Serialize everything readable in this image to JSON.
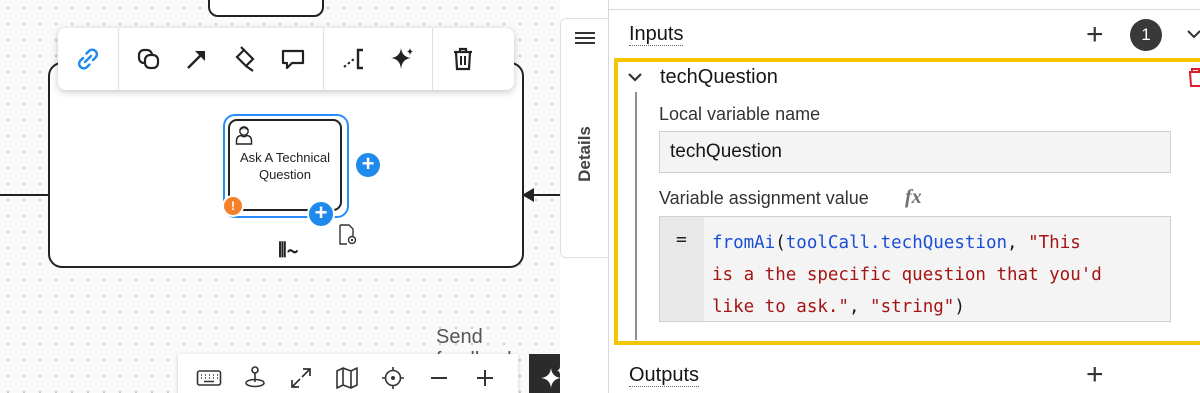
{
  "canvas": {
    "task": {
      "label": "Ask A Technical Question"
    },
    "context_toolbar": {
      "items": [
        "link-icon",
        "change-type-icon",
        "connect-arrow-icon",
        "color-bucket-icon",
        "comment-icon",
        "text-annotation-icon",
        "ai-sparkle-icon",
        "delete-icon"
      ]
    },
    "send_feedback": "Send feedback",
    "bottom_toolbar": {
      "items": [
        "keyboard-icon",
        "joystick-icon",
        "fullscreen-icon",
        "minimap-icon",
        "recenter-icon",
        "zoom-out-icon",
        "zoom-in-icon"
      ]
    },
    "loop_marker": "⦀∼",
    "warning_badge": "!"
  },
  "side_tabs": {
    "details": "Details"
  },
  "panel": {
    "inputs": {
      "title": "Inputs",
      "count": "1",
      "entry": {
        "title": "techQuestion",
        "local_var_label": "Local variable name",
        "local_var_value": "techQuestion",
        "assign_label": "Variable assignment value",
        "fx": "fx",
        "eq": "=",
        "code": {
          "fn": "fromAi",
          "open": "(",
          "arg1": "toolCall.techQuestion",
          "comma1": ", ",
          "str1_line1": "\"This",
          "str1_line2": "is a the specific question that you'd",
          "str1_line3": "like to ask.\"",
          "comma2": ", ",
          "str2": "\"string\"",
          "close": ")"
        }
      }
    },
    "outputs": {
      "title": "Outputs"
    }
  },
  "colors": {
    "selection": "#2a8dfc",
    "add_circle": "#1f8aeb",
    "warning": "#f5822a",
    "highlight": "#f5c500",
    "feel_function": "#1a4ed6",
    "feel_string": "#a31515"
  }
}
